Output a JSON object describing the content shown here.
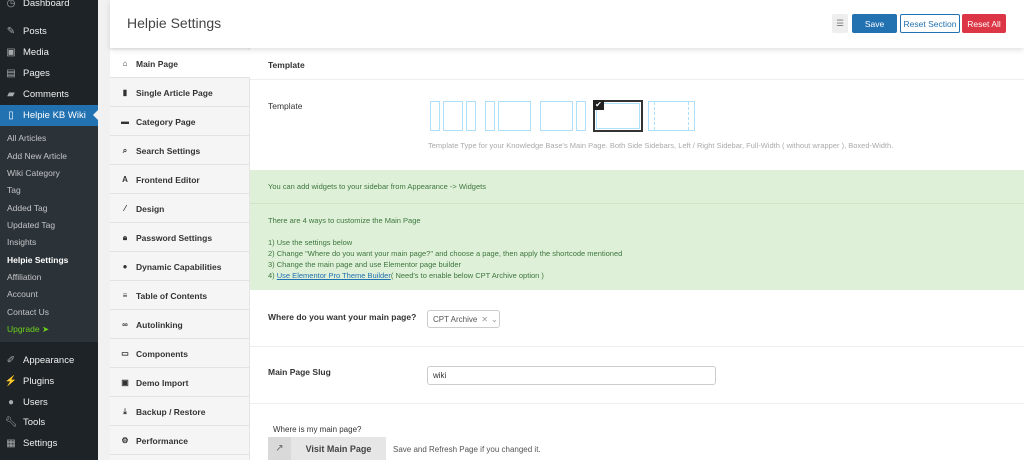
{
  "wp_menu": {
    "top": [
      {
        "label": "Dashboard",
        "icon": "dashboard-icon"
      },
      {
        "label": "Posts",
        "icon": "pin-icon"
      },
      {
        "label": "Media",
        "icon": "media-icon"
      },
      {
        "label": "Pages",
        "icon": "pages-icon"
      },
      {
        "label": "Comments",
        "icon": "comment-icon"
      }
    ],
    "active": {
      "label": "Helpie KB Wiki",
      "icon": "book-icon"
    },
    "submenu": [
      "All Articles",
      "Add New Article",
      "Wiki Category",
      "Tag",
      "Added Tag",
      "Updated Tag",
      "Insights",
      "Helpie Settings",
      "Affiliation",
      "Account",
      "Contact Us",
      "Upgrade ➤"
    ],
    "bottom": [
      {
        "label": "Appearance",
        "icon": "brush-icon"
      },
      {
        "label": "Plugins",
        "icon": "plug-icon"
      },
      {
        "label": "Users",
        "icon": "user-icon"
      },
      {
        "label": "Tools",
        "icon": "wrench-icon"
      },
      {
        "label": "Settings",
        "icon": "settings-icon"
      }
    ]
  },
  "header": {
    "title": "Helpie Settings",
    "save": "Save",
    "reset_section": "Reset Section",
    "reset_all": "Reset All"
  },
  "tabs": [
    "Main Page",
    "Single Article Page",
    "Category Page",
    "Search Settings",
    "Frontend Editor",
    "Design",
    "Password Settings",
    "Dynamic Capabilities",
    "Table of Contents",
    "Autolinking",
    "Components",
    "Demo Import",
    "Backup / Restore",
    "Performance"
  ],
  "content": {
    "section_title": "Template",
    "template_label": "Template",
    "template_options": [
      "both-sidebars",
      "left-sidebar",
      "right-sidebar",
      "full-width",
      "boxed-width"
    ],
    "template_selected": "full-width",
    "template_desc": "Template Type for your Knowledge Base's Main Page. Both Side Sidebars, Left / Right Sidebar, Full-Width ( without wrapper ), Boxed-Width.",
    "notice1": "You can add widgets to your sidebar from Appearance -> Widgets",
    "notice2": "There are 4 ways to customize the Main Page",
    "ways": [
      "1) Use the settings below",
      "2) Change \"Where do you want your main page?\" and choose a page, then apply the shortcode mentioned",
      "3) Change the main page and use Elementor page builder",
      "4) "
    ],
    "way4_link": "Use Elementor Pro Theme Builder",
    "way4_rest": "( Need's to enable below CPT Archive option )",
    "main_page_label": "Where do you want your main page?",
    "main_page_value": "CPT Archive",
    "slug_label": "Main Page Slug",
    "slug_value": "wiki",
    "where_label": "Where is my main page?",
    "visit_button": "Visit Main Page",
    "visit_note": "Save and Refresh Page if you changed it."
  }
}
